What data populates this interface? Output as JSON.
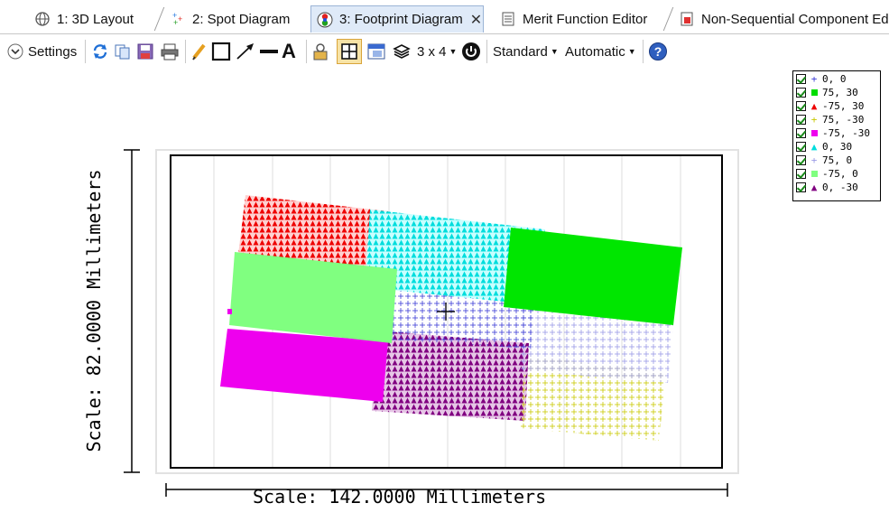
{
  "tabs": [
    {
      "label": "1: 3D Layout",
      "icon": "3d-layout-icon"
    },
    {
      "label": "2: Spot Diagram",
      "icon": "spot-diagram-icon"
    },
    {
      "label": "3: Footprint Diagram",
      "icon": "footprint-diagram-icon",
      "active": true,
      "close": "✕"
    },
    {
      "label": "Merit Function Editor",
      "icon": "merit-function-icon"
    },
    {
      "label": "Non-Sequential Component Edi",
      "icon": "nsc-editor-icon"
    }
  ],
  "toolbar": {
    "settings_label": "Settings",
    "layout_label": "3 x 4",
    "standard_label": "Standard",
    "automatic_label": "Automatic",
    "help_glyph": "?"
  },
  "plot": {
    "y_scale_label": "Scale: 82.0000 Millimeters",
    "x_scale_label": "Scale: 142.0000 Millimeters"
  },
  "legend": [
    {
      "label": "0, 0",
      "symbol": "+",
      "color": "#3b3bd6"
    },
    {
      "label": "75, 30",
      "symbol": "square",
      "color": "#00dd00"
    },
    {
      "label": "-75, 30",
      "symbol": "triangle",
      "color": "#ee0000"
    },
    {
      "label": "75, -30",
      "symbol": "+",
      "color": "#c8c800"
    },
    {
      "label": "-75, -30",
      "symbol": "square",
      "color": "#ee00ee"
    },
    {
      "label": "0, 30",
      "symbol": "triangle",
      "color": "#00dddd"
    },
    {
      "label": "75, 0",
      "symbol": "+",
      "color": "#9a9ae6"
    },
    {
      "label": "-75, 0",
      "symbol": "square",
      "color": "#80ff80"
    },
    {
      "label": "0, -30",
      "symbol": "triangle",
      "color": "#800080"
    }
  ]
}
